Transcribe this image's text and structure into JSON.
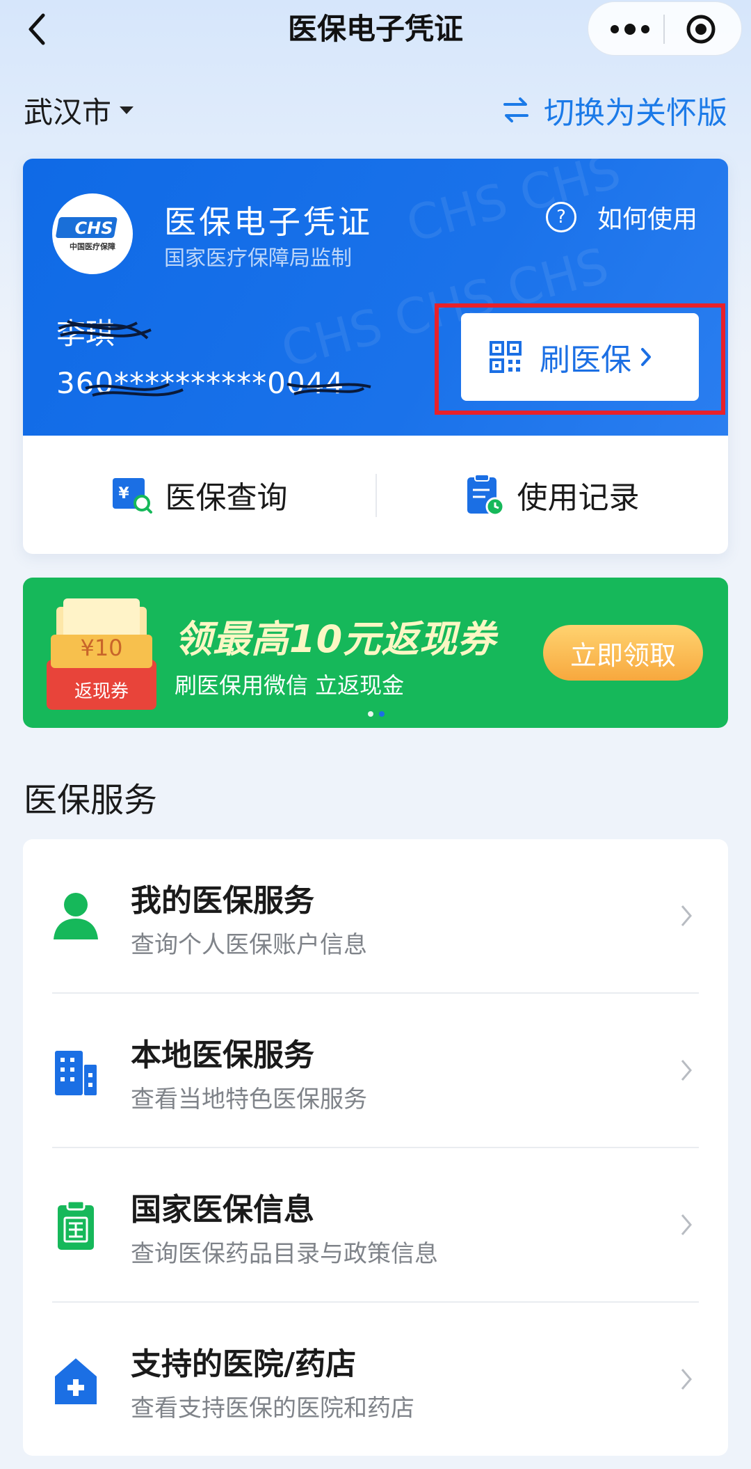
{
  "nav": {
    "title": "医保电子凭证"
  },
  "location": {
    "city": "武汉市",
    "switch_label": "切换为关怀版"
  },
  "card": {
    "title": "医保电子凭证",
    "subtitle": "国家医疗保障局监制",
    "how_to": "如何使用",
    "holder_name": "李琪",
    "id_number": "360**********0044",
    "pay_button": "刷医保",
    "logo_text": "CHS",
    "logo_caption": "中国医疗保障",
    "actions": [
      {
        "label": "医保查询",
        "icon": "yuan-search-icon"
      },
      {
        "label": "使用记录",
        "icon": "clipboard-clock-icon"
      }
    ]
  },
  "banner": {
    "coupon_amount": "¥10",
    "coupon_label": "返现券",
    "title": "领最高10元返现券",
    "subtitle": "刷医保用微信 立返现金",
    "button": "立即领取",
    "page_count": 2,
    "active_page": 2
  },
  "services": {
    "section_title": "医保服务",
    "items": [
      {
        "title": "我的医保服务",
        "desc": "查询个人医保账户信息",
        "icon": "person-icon",
        "color": "#16b85a"
      },
      {
        "title": "本地医保服务",
        "desc": "查看当地特色医保服务",
        "icon": "building-icon",
        "color": "#1b6fe4"
      },
      {
        "title": "国家医保信息",
        "desc": "查询医保药品目录与政策信息",
        "icon": "national-clipboard-icon",
        "color": "#16b85a"
      },
      {
        "title": "支持的医院/药店",
        "desc": "查看支持医保的医院和药店",
        "icon": "hospital-icon",
        "color": "#1b6fe4"
      }
    ]
  },
  "colors": {
    "accent_blue": "#1b6fe4",
    "accent_green": "#16b85a",
    "highlight_red": "#e8212a"
  }
}
